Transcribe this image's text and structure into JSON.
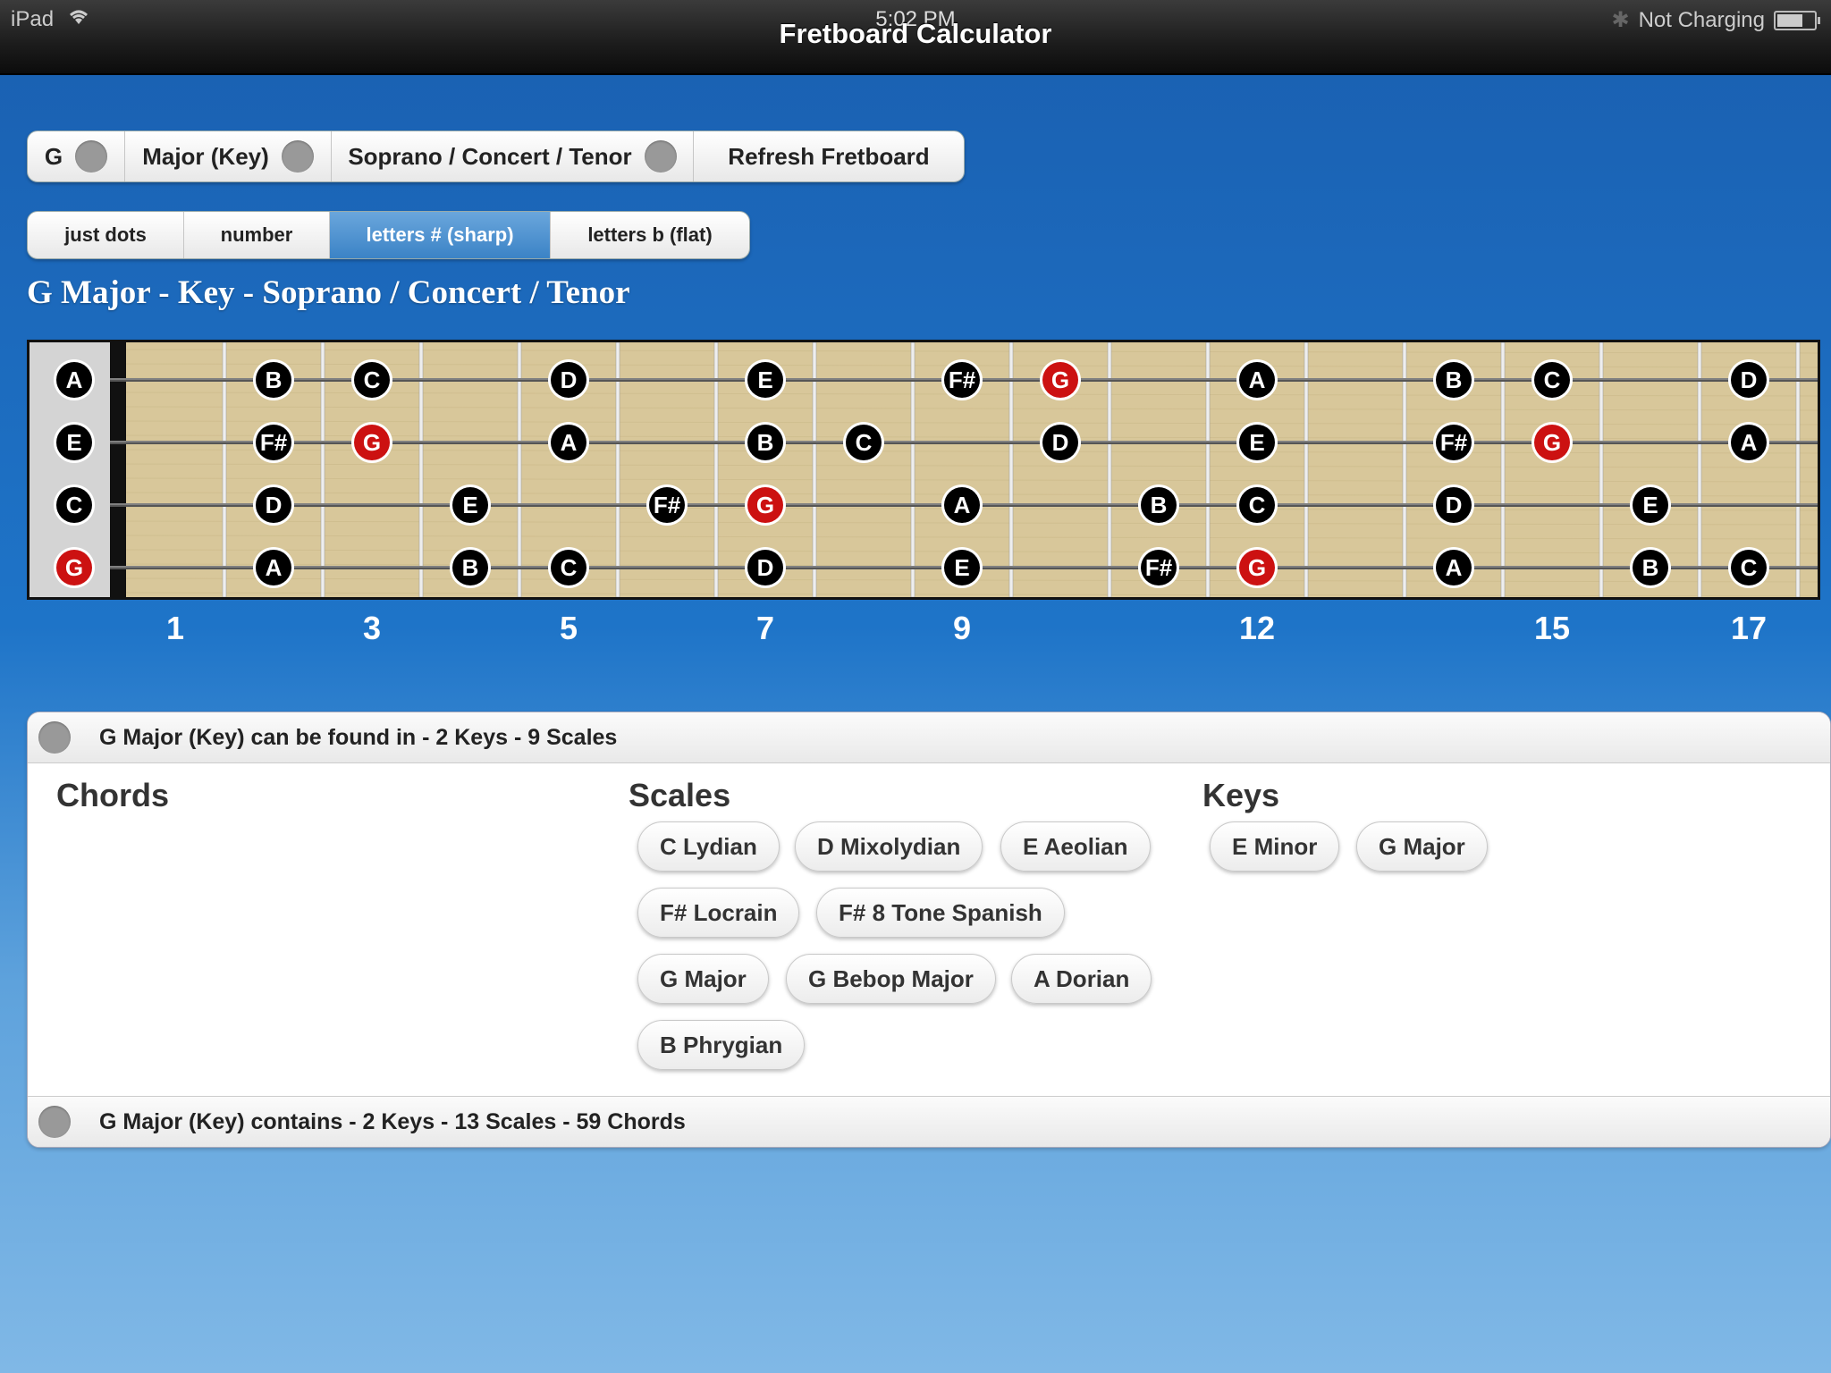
{
  "status_bar": {
    "device": "iPad",
    "time": "5:02 PM",
    "title": "Fretboard Calculator",
    "charging": "Not Charging"
  },
  "selectors": {
    "key": "G",
    "type": "Major (Key)",
    "instrument": "Soprano / Concert / Tenor",
    "refresh": "Refresh Fretboard"
  },
  "display_modes": {
    "items": [
      "just dots",
      "number",
      "letters # (sharp)",
      "letters b (flat)"
    ],
    "active": "letters # (sharp)"
  },
  "fretboard": {
    "title": "G Major - Key - Soprano / Concert / Tenor",
    "open_strings": [
      "A",
      "E",
      "C",
      "G"
    ],
    "strings": [
      [
        "",
        "",
        "B",
        "C",
        "",
        "D",
        "",
        "E",
        "",
        "F#",
        "G",
        "",
        "A",
        "",
        "B",
        "C",
        "",
        "D"
      ],
      [
        "",
        "",
        "F#",
        "G",
        "",
        "A",
        "",
        "B",
        "C",
        "",
        "D",
        "",
        "E",
        "",
        "F#",
        "G",
        "",
        "A"
      ],
      [
        "",
        "",
        "D",
        "",
        "E",
        "",
        "F#",
        "G",
        "",
        "A",
        "",
        "B",
        "C",
        "",
        "D",
        "",
        "E",
        ""
      ],
      [
        "",
        "",
        "A",
        "",
        "B",
        "C",
        "",
        "D",
        "",
        "E",
        "",
        "F#",
        "G",
        "",
        "A",
        "",
        "B",
        "C"
      ]
    ],
    "root_note": "G",
    "fret_markers": [
      "1",
      "3",
      "5",
      "7",
      "9",
      "12",
      "15",
      "17"
    ]
  },
  "panel": {
    "header_found": "G Major (Key) can be found in - 2 Keys - 9 Scales",
    "header_contains": "G Major (Key) contains - 2 Keys - 13 Scales - 59 Chords",
    "chords_title": "Chords",
    "scales_title": "Scales",
    "keys_title": "Keys",
    "scales": [
      "C Lydian",
      "D Mixolydian",
      "E Aeolian",
      "F# Locrain",
      "F# 8 Tone Spanish",
      "G Major",
      "G Bebop Major",
      "A Dorian",
      "B Phrygian"
    ],
    "keys": [
      "E Minor",
      "G Major"
    ]
  },
  "colors": {
    "root": "#cc1111",
    "note": "#000000",
    "fret_wood": "#d8c79a",
    "active_mode": "#4a90d2"
  }
}
